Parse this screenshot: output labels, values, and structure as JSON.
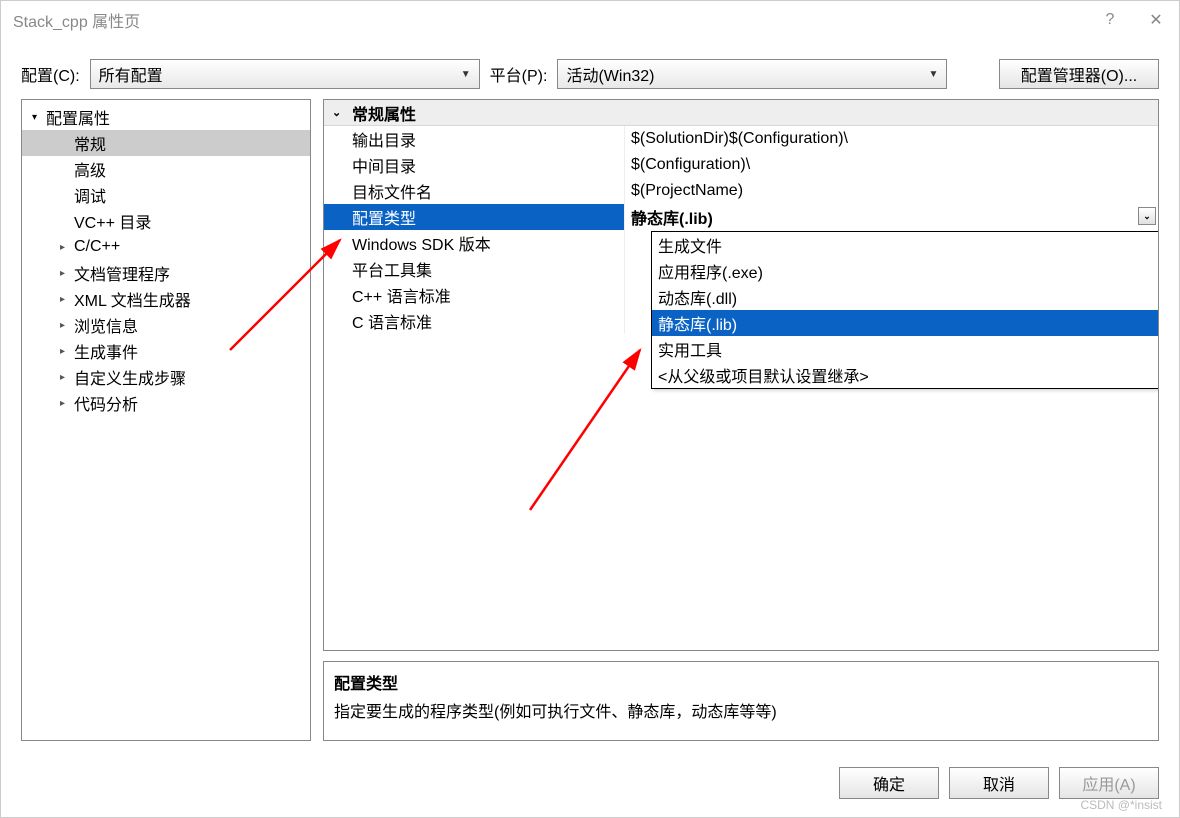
{
  "window": {
    "title": "Stack_cpp 属性页",
    "help": "?",
    "close": "✕"
  },
  "topbar": {
    "config_label": "配置(C):",
    "config_value": "所有配置",
    "platform_label": "平台(P):",
    "platform_value": "活动(Win32)",
    "config_manager": "配置管理器(O)..."
  },
  "tree": {
    "root": "配置属性",
    "general": "常规",
    "advanced": "高级",
    "debug": "调试",
    "vcdir": "VC++ 目录",
    "cpp": "C/C++",
    "docmgr": "文档管理程序",
    "xmlgen": "XML 文档生成器",
    "browse": "浏览信息",
    "buildevents": "生成事件",
    "custombuild": "自定义生成步骤",
    "codeanalysis": "代码分析"
  },
  "grid": {
    "group": "常规属性",
    "rows": [
      {
        "name": "输出目录",
        "value": "$(SolutionDir)$(Configuration)\\"
      },
      {
        "name": "中间目录",
        "value": "$(Configuration)\\"
      },
      {
        "name": "目标文件名",
        "value": "$(ProjectName)"
      },
      {
        "name": "配置类型",
        "value": "静态库(.lib)",
        "selected": true
      },
      {
        "name": "Windows SDK 版本",
        "value": ""
      },
      {
        "name": "平台工具集",
        "value": ""
      },
      {
        "name": "C++ 语言标准",
        "value": ""
      },
      {
        "name": "C 语言标准",
        "value": ""
      }
    ]
  },
  "dropdown": {
    "items": [
      "生成文件",
      "应用程序(.exe)",
      "动态库(.dll)",
      "静态库(.lib)",
      "实用工具",
      "<从父级或项目默认设置继承>"
    ],
    "selected_index": 3
  },
  "desc": {
    "title": "配置类型",
    "text": "指定要生成的程序类型(例如可执行文件、静态库，动态库等等)"
  },
  "footer": {
    "ok": "确定",
    "cancel": "取消",
    "apply": "应用(A)"
  },
  "watermark": "CSDN @*insist"
}
